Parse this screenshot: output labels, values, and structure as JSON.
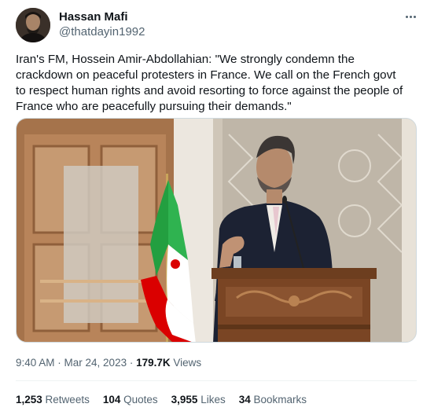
{
  "author": {
    "display_name": "Hassan Mafi",
    "handle": "@thatdayin1992",
    "avatar_icon": "person-avatar"
  },
  "more_icon": "more-horizontal-icon",
  "tweet_text": "Iran's FM, Hossein Amir-Abdollahian: \"We strongly condemn the crackdown on peaceful protesters in France. We call on the French govt to respect human rights and avoid resorting to force against the people of France who are peacefully pursuing their demands.\"",
  "meta": {
    "time": "9:40 AM",
    "separator": " · ",
    "date": "Mar 24, 2023",
    "views_count": "179.7K",
    "views_label": " Views"
  },
  "stats": {
    "retweets": {
      "count": "1,253",
      "label": " Retweets"
    },
    "quotes": {
      "count": "104",
      "label": " Quotes"
    },
    "likes": {
      "count": "3,955",
      "label": " Likes"
    },
    "bookmarks": {
      "count": "34",
      "label": " Bookmarks"
    }
  },
  "colors": {
    "text_primary": "#0f1419",
    "text_secondary": "#536471",
    "divider": "#eff3f4",
    "flag_green": "#239f40",
    "flag_white": "#ffffff",
    "flag_red": "#da0000"
  }
}
